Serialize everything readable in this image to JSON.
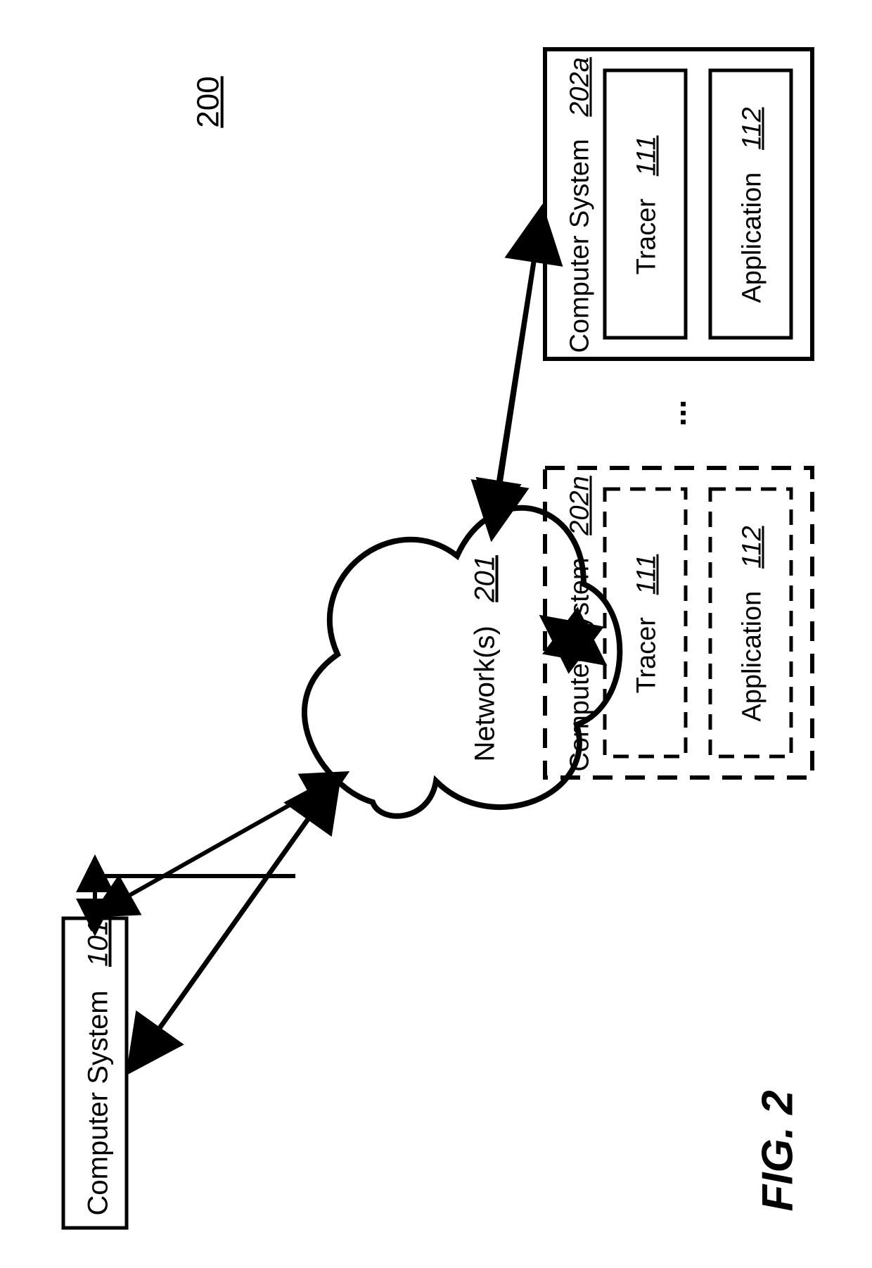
{
  "figure": {
    "number_label": "200",
    "caption": "FIG. 2"
  },
  "nodes": {
    "left_system": {
      "label": "Computer System",
      "ref": "101"
    },
    "network": {
      "label": "Network(s)",
      "ref": "201"
    },
    "right_top": {
      "title_label": "Computer System",
      "title_ref": "202a",
      "tracer_label": "Tracer",
      "tracer_ref": "111",
      "app_label": "Application",
      "app_ref": "112"
    },
    "right_bottom": {
      "title_label": "Computer System",
      "title_ref": "202n",
      "tracer_label": "Tracer",
      "tracer_ref": "111",
      "app_label": "Application",
      "app_ref": "112"
    },
    "ellipsis": "..."
  }
}
